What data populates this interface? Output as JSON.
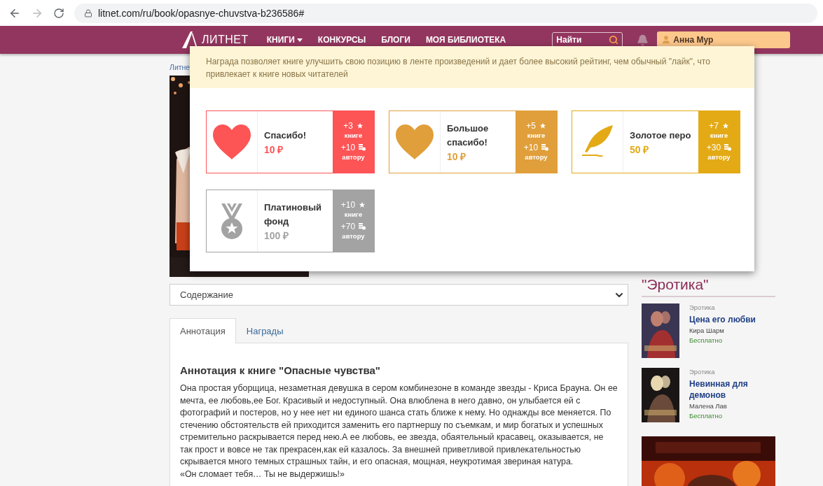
{
  "browser": {
    "url": "litnet.com/ru/book/opasnye-chuvstva-b236586#"
  },
  "nav": {
    "logo": "ЛИТНЕТ",
    "items": [
      {
        "label": "КНИГИ",
        "dropdown": true
      },
      {
        "label": "КОНКУРСЫ",
        "dropdown": false
      },
      {
        "label": "БЛОГИ",
        "dropdown": false
      },
      {
        "label": "МОЯ БИБЛИОТЕКА",
        "dropdown": false
      }
    ],
    "search": {
      "placeholder": "Найти"
    },
    "user": "Анна Мур"
  },
  "breadcrumb": "Литне",
  "popup": {
    "notice": "Награда позволяет книге улучшить свою позицию в ленте произведений и дает более высокий рейтинг, чем обычный \"лайк\", что привлекает к книге новых читателей",
    "awards": [
      {
        "kind": "heart",
        "name": "Спасибо!",
        "price": "10 ₽",
        "book_points": "+3",
        "book_label": "книге",
        "author_points": "+10",
        "author_label": "автору",
        "color": "#fd5456"
      },
      {
        "kind": "heart",
        "name": "Большое спасибо!",
        "price": "10 ₽",
        "book_points": "+5",
        "book_label": "книге",
        "author_points": "+10",
        "author_label": "автору",
        "color": "#e09f3a"
      },
      {
        "kind": "feather",
        "name": "Золотое перо",
        "price": "50 ₽",
        "book_points": "+7",
        "book_label": "книге",
        "author_points": "+30",
        "author_label": "автору",
        "color": "#e3aa16"
      },
      {
        "kind": "medal",
        "name": "Платиновый фонд",
        "price": "100 ₽",
        "book_points": "+10",
        "book_label": "книге",
        "author_points": "+70",
        "author_label": "автору",
        "color": "#a3a3a3"
      }
    ]
  },
  "contents_select": "Содержание",
  "tabs": [
    {
      "label": "Аннотация",
      "selected": true
    },
    {
      "label": "Награды",
      "selected": false
    }
  ],
  "annotation": {
    "title": "Аннотация к книге \"Опасные чувства\"",
    "lines": [
      "Она простая уборщица, незаметная девушка в сером комбинезоне в команде звезды - Криса Брауна. Он ее мечта, ее любовь,ее Бог. Красивый и недоступный. Она влюблена в него давно, он улыбается ей с фотографий и постеров, но у нее нет ни единого шанса стать ближе к нему. Но однажды все меняется. По стечению обстоятельств ей приходится заменить его партнершу по съемкам, и мир богатых и успешных стремительно раскрывается перед нею.А ее любовь, ее звезда, обаятельный красавец, оказывается, не так прост и вовсе не так прекрасен,как ей казалось. За внешней приветливой привлекательностью скрывается много темных страшных тайн, и его опасная, мощная, неукротимая звериная натура.",
      "«Он сломает тебя… Ты не выдержишь!»"
    ]
  },
  "sidebar": {
    "heading": "\"Эротика\"",
    "books": [
      {
        "genre": "Эротика",
        "title": "Цена его любви",
        "author": "Кира Шарм",
        "price": "Бесплатно"
      },
      {
        "genre": "Эротика",
        "title": "Невинная для демонов",
        "author": "Малена Лав",
        "price": "Бесплатно"
      }
    ]
  }
}
